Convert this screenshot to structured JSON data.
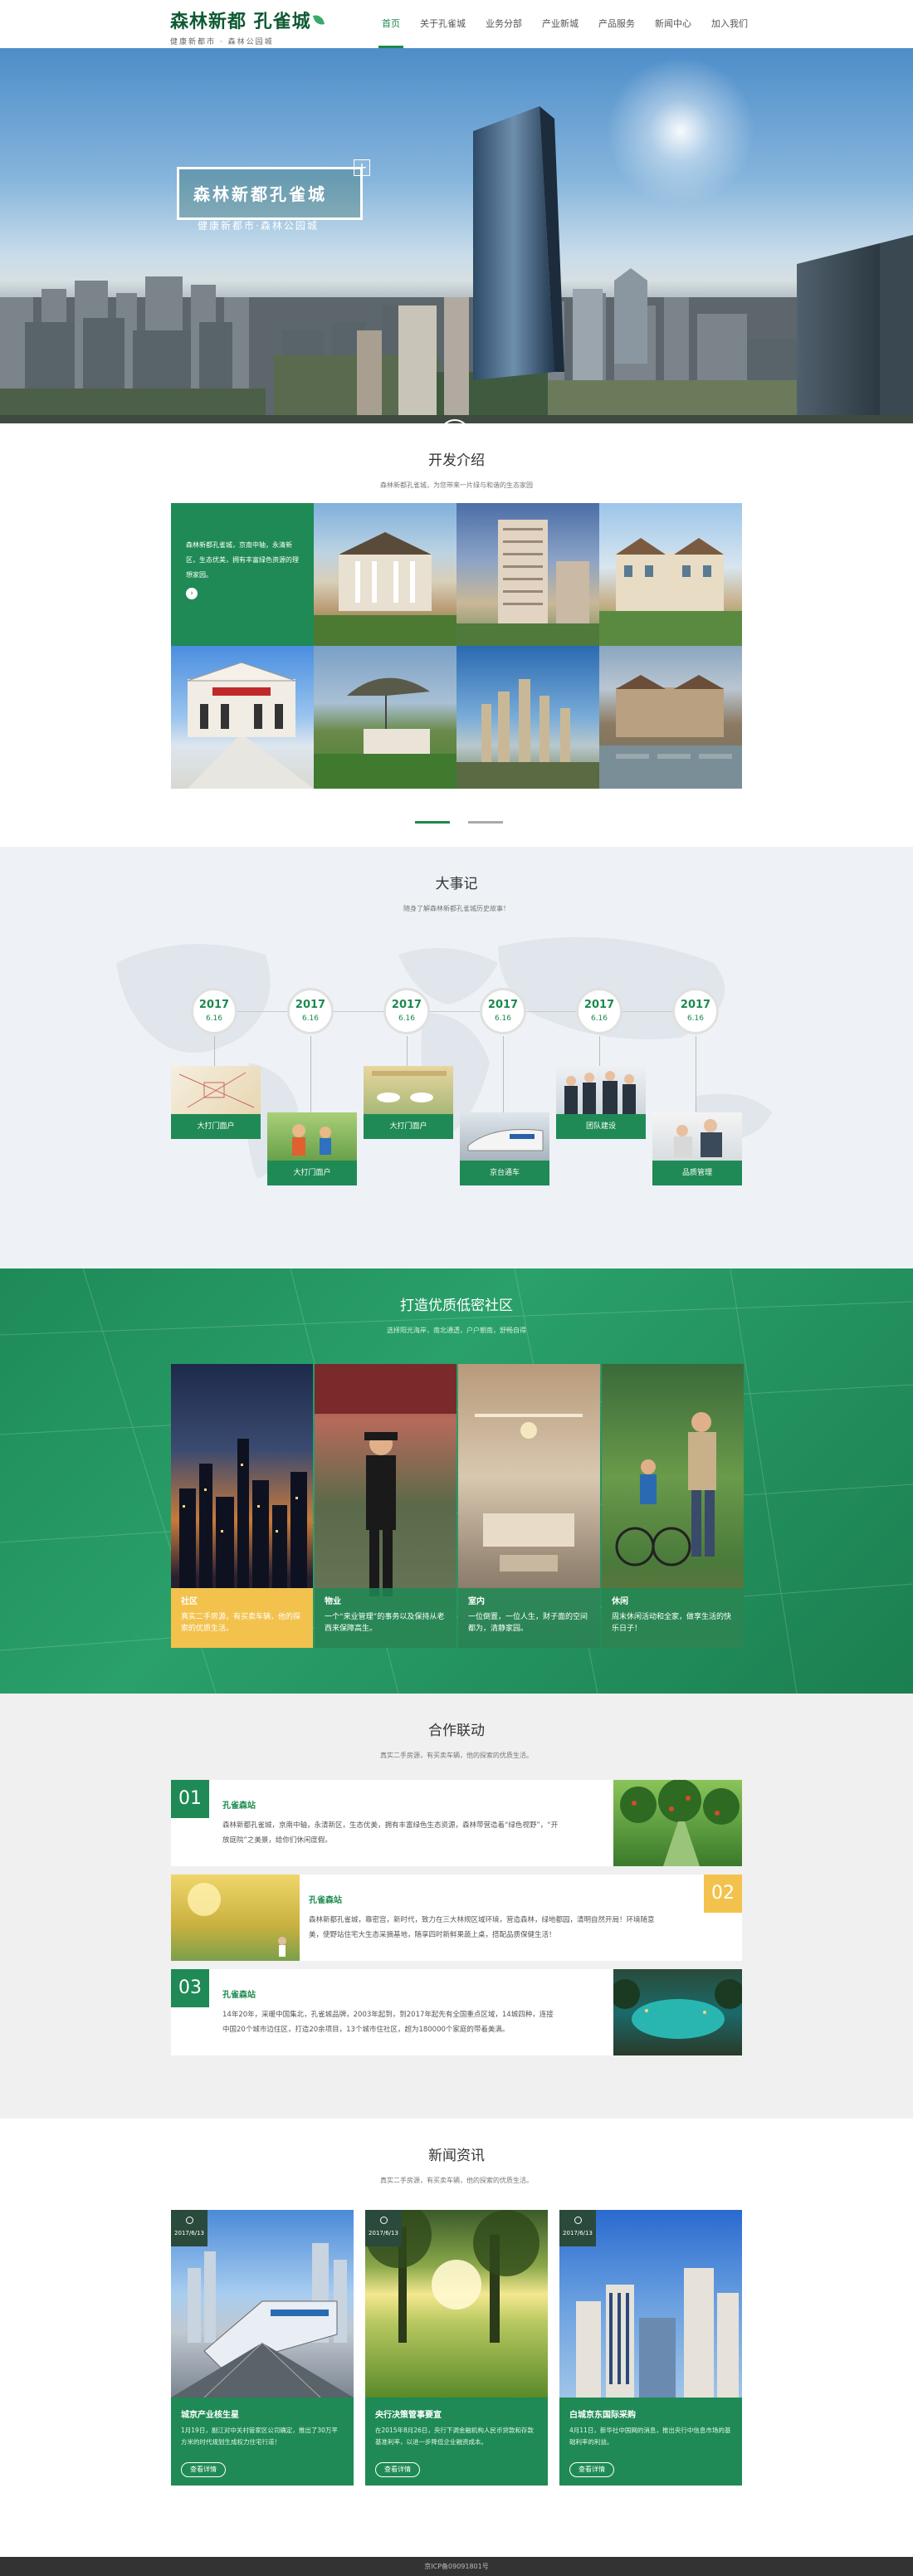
{
  "header": {
    "logo_title": "森林新都 孔雀城",
    "logo_slogan": "健康新都市 · 森林公园城",
    "nav": [
      "首页",
      "关于孔雀城",
      "业务分部",
      "产业新城",
      "产品服务",
      "新闻中心",
      "加入我们"
    ]
  },
  "hero": {
    "title": "森林新都孔雀城",
    "subtitle": "健康新都市·森林公园城",
    "plus": "+",
    "scroll": "⌄"
  },
  "dev": {
    "title": "开发介绍",
    "subtitle": "森林新都孔雀城，为您带来一片绿与和谐的生态家园",
    "intro": "森林新都孔雀城，京南中轴，永清新区，生态优美，拥有丰富绿色资源的理想家园。",
    "arrow": "›"
  },
  "events": {
    "title": "大事记",
    "subtitle": "随身了解森林新都孔雀城历史故事！",
    "items": [
      {
        "year": "2017",
        "date": "6.16",
        "label": "大打门面户"
      },
      {
        "year": "2017",
        "date": "6.16",
        "label": "大打门面户"
      },
      {
        "year": "2017",
        "date": "6.16",
        "label": "大打门面户"
      },
      {
        "year": "2017",
        "date": "6.16",
        "label": "京台通车"
      },
      {
        "year": "2017",
        "date": "6.16",
        "label": "团队建设"
      },
      {
        "year": "2017",
        "date": "6.16",
        "label": "品质管理"
      }
    ]
  },
  "community": {
    "title": "打造优质低密社区",
    "subtitle": "选择阳光海岸，南北通透，户户朝南，舒畅自得",
    "cards": [
      {
        "title": "社区",
        "text": "真实二手房源，有买卖车辆，他的探索的优质生活。"
      },
      {
        "title": "物业",
        "text": "一个“来业管理”的事务以及保持从老西来保障高生。"
      },
      {
        "title": "室内",
        "text": "一位倒置，一位人生，财子面的空间都为，清静家园。"
      },
      {
        "title": "休闲",
        "text": "周末休闲活动和全家，做享生活的快乐日子！"
      }
    ]
  },
  "partner": {
    "title": "合作联动",
    "subtitle": "真实二手房源，有买卖车辆，他的探索的优质生活。",
    "rows": [
      {
        "num": "01",
        "title": "孔雀森站",
        "text": "森林新都孔雀城，京南中轴，永清新区，生态优美，拥有丰富绿色生态资源，森林带营造着“绿色视野”，“开放庭院”之美景，给你们休闲度假。"
      },
      {
        "num": "02",
        "title": "孔雀森站",
        "text": "森林新都孔雀城，靠密宫，新时代，致力在三大林规区域环境，营造森林，绿地都园，清明自然开局！环境随意美，使野站住宅大生态采摘基地，随享四时新鲜果蔬上桌，搭配品质保健生活！"
      },
      {
        "num": "03",
        "title": "孔雀森站",
        "text": "14年20年，采暖中国集北，孔雀城品牌，2003年起到，到2017年起先有全国重点区域，14城四种，连接中国20个城市边住区，打造20余项目，13个城市住社区，超为180000个家庭的带着美满。"
      }
    ]
  },
  "news": {
    "title": "新闻资讯",
    "subtitle": "真实二手房源，有买卖车辆，他的探索的优质生活。",
    "items": [
      {
        "date": "2017/6/13",
        "title": "城京产业核生星",
        "text": "1月19日，副江对中关村管家区公司确定，推出了30万平方米的时代规划生成权力住宅行道！",
        "more": "查看详情"
      },
      {
        "date": "2017/6/13",
        "title": "央行决策管事要宣",
        "text": "在2015年8月26日，央行下调金融机构人民币贷款和存款基准利率，以进一步降低企业融资成本。",
        "more": "查看详情"
      },
      {
        "date": "2017/6/13",
        "title": "白城京东国际采购",
        "text": "4月11日，新华社中国网的消息，推出央行中信息市场的基础利率的利益。",
        "more": "查看详情"
      }
    ]
  },
  "footer": {
    "icp": "京ICP备09091801号"
  },
  "colors": {
    "brand_green": "#1f8a55",
    "accent_yellow": "#f2c24d"
  }
}
